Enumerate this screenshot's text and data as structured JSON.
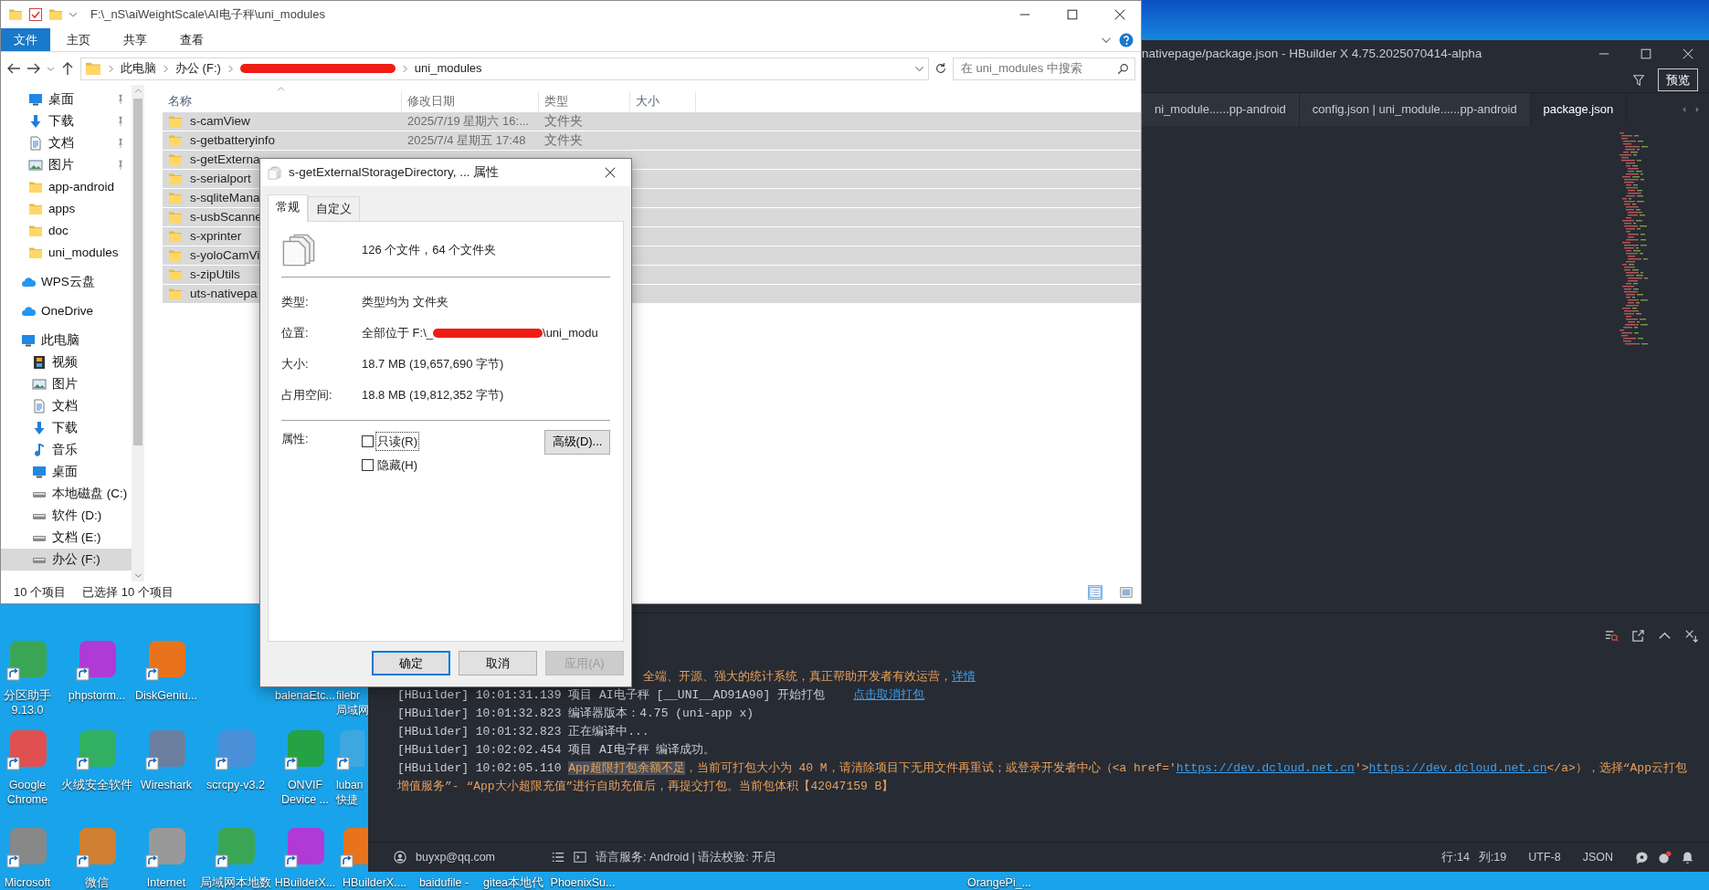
{
  "desktop": {
    "icon_rows": [
      [
        {
          "label_lines": [
            "分区助手",
            "9.13.0"
          ]
        },
        {
          "label_lines": [
            "phpstorm..."
          ]
        },
        {
          "label_lines": [
            "DiskGeniu..."
          ]
        },
        {
          "label_lines": [
            "balenaEtc..."
          ]
        },
        {
          "label_lines": [
            "filebr",
            "局域网"
          ]
        }
      ],
      [
        {
          "label_lines": [
            "Google",
            "Chrome"
          ]
        },
        {
          "label_lines": [
            "火绒安全软件"
          ]
        },
        {
          "label_lines": [
            "Wireshark"
          ]
        },
        {
          "label_lines": [
            "scrcpy-v3.2"
          ]
        },
        {
          "label_lines": [
            "ONVIF",
            "Device ..."
          ]
        },
        {
          "label_lines": [
            "luban",
            "快捷"
          ]
        }
      ],
      [
        {
          "label_lines": [
            "Microsoft"
          ]
        },
        {
          "label_lines": [
            "微信"
          ]
        },
        {
          "label_lines": [
            "Internet"
          ]
        },
        {
          "label_lines": [
            "局域网本地数"
          ]
        },
        {
          "label_lines": [
            "HBuilderX..."
          ]
        },
        {
          "label_lines": [
            "HBuilderX...."
          ]
        },
        {
          "label_lines": [
            "baidufile -"
          ]
        },
        {
          "label_lines": [
            "gitea本地代"
          ]
        },
        {
          "label_lines": [
            "PhoenixSu..."
          ]
        },
        {
          "label_lines": [
            "OrangePi_..."
          ]
        }
      ]
    ]
  },
  "explorer": {
    "title": "F:\\_nS\\aiWeightScale\\AI电子秤\\uni_modules",
    "ribbon_tabs": [
      {
        "label": "文件",
        "kind": "file"
      },
      {
        "label": "主页",
        "kind": "tab"
      },
      {
        "label": "共享",
        "kind": "tab"
      },
      {
        "label": "查看",
        "kind": "tab"
      }
    ],
    "path": [
      {
        "kind": "crumb",
        "text": "此电脑"
      },
      {
        "kind": "crumb",
        "text": "办公 (F:)"
      },
      {
        "kind": "redacted"
      },
      {
        "kind": "crumb",
        "text": "uni_modules"
      }
    ],
    "search": {
      "placeholder": "在 uni_modules 中搜索"
    },
    "quick_access": [
      {
        "label": "桌面",
        "pinned": true,
        "selected": false
      },
      {
        "label": "下载",
        "pinned": true,
        "selected": false
      },
      {
        "label": "文档",
        "pinned": true,
        "selected": false
      },
      {
        "label": "图片",
        "pinned": true,
        "selected": false
      },
      {
        "label": "app-android",
        "pinned": false,
        "selected": false
      },
      {
        "label": "apps",
        "pinned": false,
        "selected": false
      },
      {
        "label": "doc",
        "pinned": false,
        "selected": false
      },
      {
        "label": "uni_modules",
        "pinned": false,
        "selected": false
      }
    ],
    "nav_roots": [
      {
        "label": "WPS云盘",
        "selected": false
      },
      {
        "label": "OneDrive",
        "selected": false
      },
      {
        "label": "此电脑",
        "selected": false,
        "children": [
          {
            "label": "视频",
            "selected": false
          },
          {
            "label": "图片",
            "selected": false
          },
          {
            "label": "文档",
            "selected": false
          },
          {
            "label": "下载",
            "selected": false
          },
          {
            "label": "音乐",
            "selected": false
          },
          {
            "label": "桌面",
            "selected": false
          },
          {
            "label": "本地磁盘 (C:)",
            "selected": false
          },
          {
            "label": "软件 (D:)",
            "selected": false
          },
          {
            "label": "文档 (E:)",
            "selected": false
          },
          {
            "label": "办公 (F:)",
            "selected": true
          }
        ]
      }
    ],
    "columns": [
      "名称",
      "修改日期",
      "类型",
      "大小"
    ],
    "rows": [
      {
        "name": "s-camView",
        "modified": "2025/7/19 星期六 16:...",
        "type": "文件夹",
        "selected": true
      },
      {
        "name": "s-getbatteryinfo",
        "modified": "2025/7/4 星期五 17:48",
        "type": "文件夹",
        "selected": true
      },
      {
        "name": "s-getExterna",
        "selected": true
      },
      {
        "name": "s-serialport",
        "selected": true
      },
      {
        "name": "s-sqliteMana",
        "selected": true
      },
      {
        "name": "s-usbScanne",
        "selected": true
      },
      {
        "name": "s-xprinter",
        "selected": true
      },
      {
        "name": "s-yoloCamVi",
        "selected": true
      },
      {
        "name": "s-zipUtils",
        "selected": true
      },
      {
        "name": "uts-nativepa",
        "selected": true
      }
    ],
    "status": [
      "10 个项目",
      "已选择 10 个项目"
    ],
    "view_buttons": [
      {
        "selected": true
      },
      {
        "selected": false
      }
    ]
  },
  "properties_dialog": {
    "title": "s-getExternalStorageDirectory, ... 属性",
    "tabs": [
      {
        "label": "常规",
        "selected": true
      },
      {
        "label": "自定义",
        "selected": false
      }
    ],
    "summary": "126 个文件，64 个文件夹",
    "fields": [
      {
        "kind": "text",
        "label": "类型:",
        "value": "类型均为 文件夹"
      },
      {
        "kind": "redacted",
        "label": "位置:",
        "value_parts": [
          "全部位于 F:\\_",
          "\\uni_modu"
        ]
      },
      {
        "kind": "text",
        "label": "大小:",
        "value": "18.7 MB (19,657,690 字节)"
      },
      {
        "kind": "text",
        "label": "占用空间:",
        "value": "18.8 MB (19,812,352 字节)"
      }
    ],
    "attributes_label": "属性:",
    "checkboxes": [
      {
        "label": "只读(R)",
        "checked": false,
        "focused": true
      },
      {
        "label": "隐藏(H)",
        "checked": false,
        "focused": false
      }
    ],
    "advanced_button": "高级(D)...",
    "buttons": [
      {
        "label": "确定",
        "default": true,
        "disabled": false
      },
      {
        "label": "取消",
        "default": false,
        "disabled": false
      },
      {
        "label": "应用(A)",
        "default": false,
        "disabled": true
      }
    ]
  },
  "hbuilder": {
    "title": "nativepage/package.json - HBuilder X 4.75.2025070414-alpha",
    "preview_button": "预览",
    "tabs": [
      {
        "label": "ni_module......pp-android",
        "selected": false
      },
      {
        "label": "config.json | uni_module......pp-android",
        "selected": false
      },
      {
        "label": "package.json",
        "selected": true
      }
    ],
    "console": [
      {
        "segments": [
          {
            "kind": "warn",
            "text": "全端、开源、强大的统计系统，真正帮助开发者有效运营，"
          },
          {
            "kind": "link",
            "text": "详情"
          }
        ]
      },
      {
        "segments": [
          {
            "kind": "text",
            "text": "[HBuilder] 10:01:31.139 项目 AI电子秤 [__UNI__AD91A90] 开始打包    "
          },
          {
            "kind": "link",
            "text": "点击取消打包"
          }
        ]
      },
      {
        "segments": [
          {
            "kind": "text",
            "text": "[HBuilder] 10:01:32.823 编译器版本：4.75 (uni-app x)"
          }
        ]
      },
      {
        "segments": [
          {
            "kind": "text",
            "text": "[HBuilder] 10:01:32.823 正在编译中..."
          }
        ]
      },
      {
        "segments": [
          {
            "kind": "text",
            "text": "[HBuilder] 10:02:02.454 项目 AI电子秤 编译成功。"
          }
        ]
      },
      {
        "segments": [
          {
            "kind": "text",
            "text": "[HBuilder] 10:02:05.110 "
          },
          {
            "kind": "highlight",
            "text": "App超限打包余额不足"
          },
          {
            "kind": "warn",
            "text": "，当前可打包大小为 40 M，请清除项目下无用文件再重试；或登录开发者中心（<a href='"
          },
          {
            "kind": "link",
            "text": "https://dev.dcloud.net.cn"
          },
          {
            "kind": "warn",
            "text": "'>"
          },
          {
            "kind": "link",
            "text": "https://dev.dcloud.net.cn"
          },
          {
            "kind": "warn",
            "text": "</a>），选择“App云打包增值服务”- “App大小超限充值”进行自助充值后，再提交打包。当前包体积【42047159 B】"
          }
        ]
      }
    ],
    "status": {
      "user": "buyxp@qq.com",
      "language": "语言服务: Android | 语法校验: 开启",
      "cursor": [
        "行:14",
        "列:19"
      ],
      "encoding": "UTF-8",
      "file_type": "JSON"
    }
  }
}
